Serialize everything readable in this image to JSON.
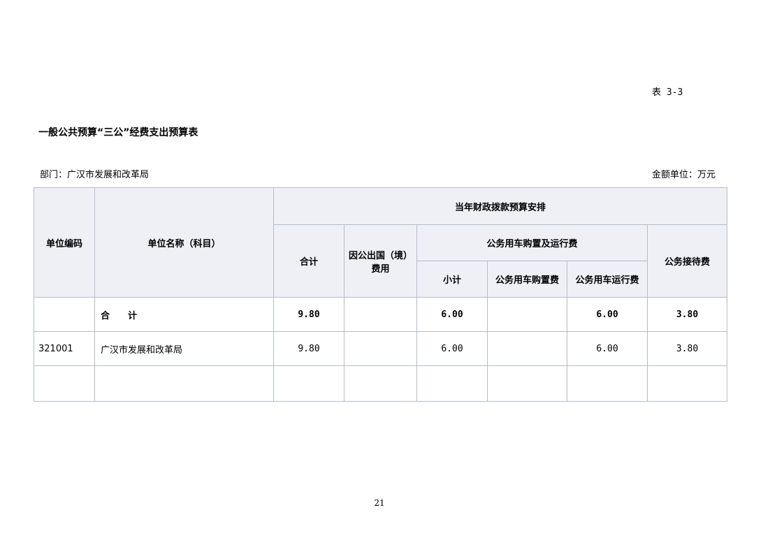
{
  "table_no": "表 3-3",
  "title": "一般公共预算“三公”经费支出预算表",
  "department": "部门：广汉市发展和改革局",
  "unit": "金额单位：万元",
  "headers": {
    "unit_code": "单位编码",
    "unit_name": "单位名称（科目）",
    "current_year": "当年财政拨款预算安排",
    "total": "合计",
    "abroad_line1": "因公出国（境）",
    "abroad_line2": "费用",
    "vehicle_group": "公务用车购置及运行费",
    "subtotal": "小计",
    "vehicle_purchase": "公务用车购置费",
    "vehicle_operation": "公务用车运行费",
    "reception": "公务接待费"
  },
  "total_row": {
    "code": "",
    "name": "合　　计",
    "total": "9.80",
    "abroad": "",
    "subtotal": "6.00",
    "purchase": "",
    "operation": "6.00",
    "reception": "3.80"
  },
  "rows": [
    {
      "code": "321001",
      "name": "广汉市发展和改革局",
      "total": "9.80",
      "abroad": "",
      "subtotal": "6.00",
      "purchase": "",
      "operation": "6.00",
      "reception": "3.80"
    }
  ],
  "page_number": "21"
}
